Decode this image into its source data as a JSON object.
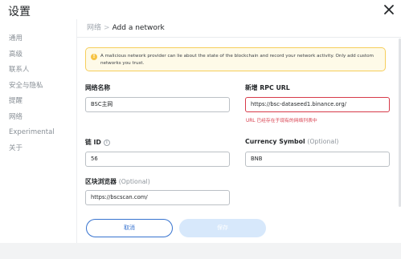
{
  "header": {
    "title": "设置"
  },
  "sidebar": {
    "items": [
      {
        "label": "通用"
      },
      {
        "label": "高级"
      },
      {
        "label": "联系人"
      },
      {
        "label": "安全与隐私"
      },
      {
        "label": "提醒"
      },
      {
        "label": "网络"
      },
      {
        "label": "Experimental"
      },
      {
        "label": "关于"
      }
    ]
  },
  "breadcrumb": {
    "parent": "网络",
    "separator": ">",
    "current": "Add a network"
  },
  "warning": {
    "icon": "!",
    "text": "A malicious network provider can lie about the state of the blockchain and record your network activity. Only add custom networks you trust."
  },
  "form": {
    "network_name": {
      "label": "网络名称",
      "value": "BSC主网"
    },
    "rpc_url": {
      "label": "新增 RPC URL",
      "value": "https://bsc-dataseed1.binance.org/",
      "error": "URL 已经存在于现有的网络列表中"
    },
    "chain_id": {
      "label": "链 ID",
      "info_icon": "i",
      "value": "56"
    },
    "currency_symbol": {
      "label": "Currency Symbol",
      "optional": "(Optional)",
      "value": "BNB"
    },
    "block_explorer": {
      "label": "区块浏览器",
      "optional": "(Optional)",
      "value": "https://bscscan.com/"
    }
  },
  "buttons": {
    "cancel": "取消",
    "save": "保存"
  },
  "colors": {
    "primary": "#3773cf",
    "error": "#d73a49",
    "warning_bg": "#fefae8",
    "warning_border": "#f6ce5b",
    "disabled_button": "#d7e8fb"
  }
}
